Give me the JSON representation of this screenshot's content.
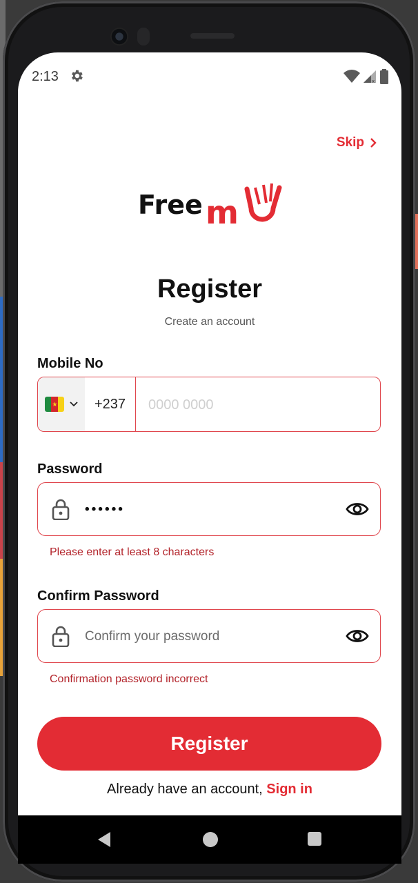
{
  "status": {
    "time": "2:13"
  },
  "skip_label": "Skip",
  "brand": {
    "name_black": "Free",
    "name_red": "m",
    "accent": "#e32c34"
  },
  "title": "Register",
  "subtitle": "Create an account",
  "mobile": {
    "label": "Mobile No",
    "country_flag": "cameroon-flag",
    "dial_code": "+237",
    "placeholder": "0000 0000",
    "value": ""
  },
  "password": {
    "label": "Password",
    "value": "••••••",
    "error": "Please enter at least 8 characters"
  },
  "confirm": {
    "label": "Confirm Password",
    "placeholder": "Confirm your password",
    "value": "",
    "error": "Confirmation password incorrect"
  },
  "register_button": "Register",
  "signin_prompt": "Already have an account,",
  "signin_link": "Sign in"
}
